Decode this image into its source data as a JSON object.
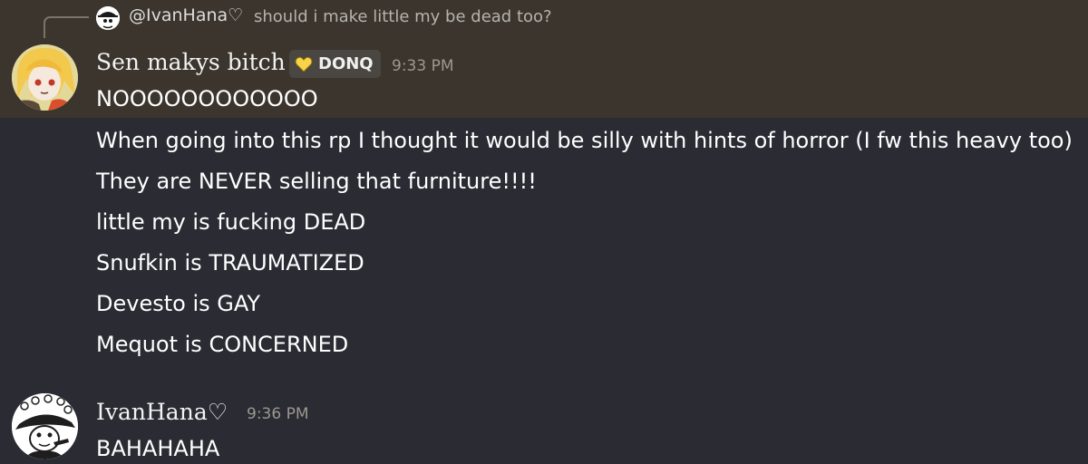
{
  "reply": {
    "username": "@IvanHana♡",
    "text": "should i make little my be dead too?"
  },
  "message1": {
    "author": "Sen makys bitch",
    "tag": "DONQ",
    "timestamp": "9:33 PM",
    "lines": [
      "NOOOOOOOOOOOO",
      "When going into this rp I thought it would be silly with hints of horror (I fw this heavy too)",
      "They are NEVER selling that furniture!!!!",
      "little my is fucking DEAD",
      "Snufkin is TRAUMATIZED",
      "Devesto is GAY",
      "Mequot is CONCERNED"
    ]
  },
  "message2": {
    "author": "IvanHana♡",
    "timestamp": "9:36 PM",
    "lines": [
      "BAHAHAHA"
    ]
  },
  "colors": {
    "background": "#2a2b33",
    "highlight": "#3b352d",
    "tag_heart": "#f5d547",
    "timestamp": "#9c9890"
  },
  "icons": {
    "tag": "heart-icon",
    "reply": "reply-spine"
  }
}
